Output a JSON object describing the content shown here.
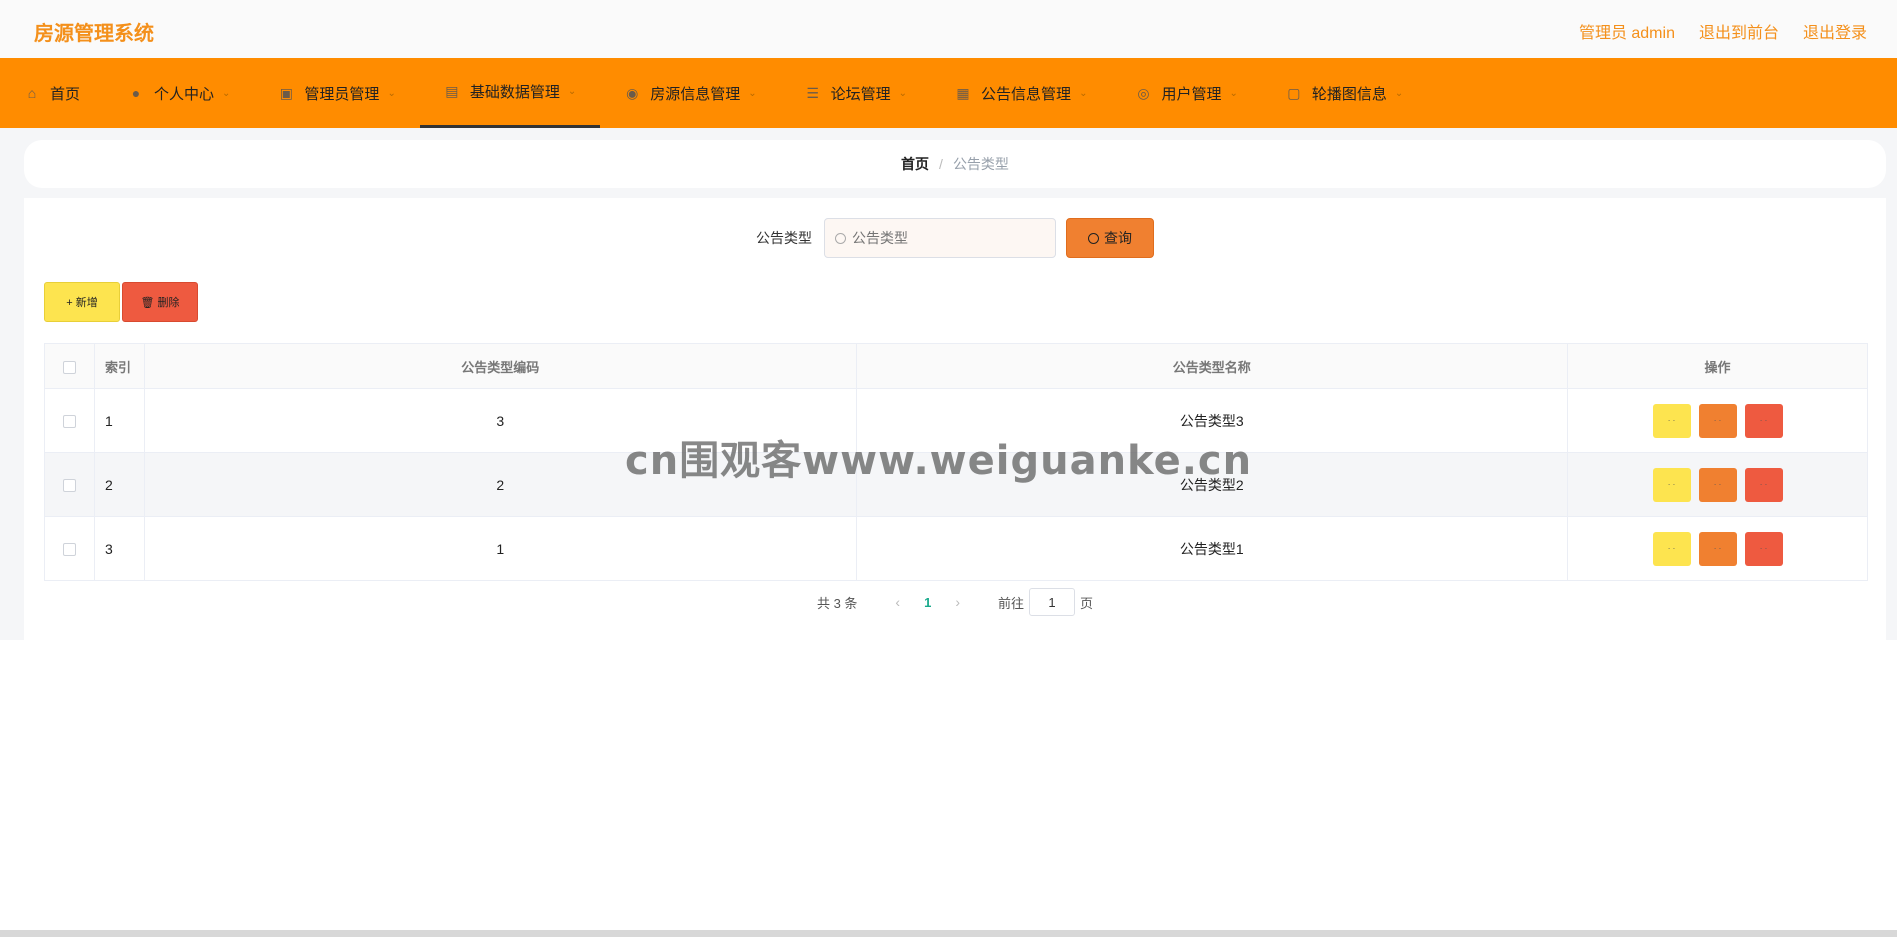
{
  "app": {
    "title": "房源管理系统",
    "top_links": [
      "管理员 admin",
      "退出到前台",
      "退出登录"
    ]
  },
  "nav": {
    "items": [
      {
        "label": "首页",
        "icon": "home-icon",
        "glyph": "⌂",
        "has_menu": false,
        "active": false
      },
      {
        "label": "个人中心",
        "icon": "user-icon",
        "glyph": "●",
        "has_menu": true,
        "active": false
      },
      {
        "label": "管理员管理",
        "icon": "monitor-icon",
        "glyph": "▣",
        "has_menu": true,
        "active": false
      },
      {
        "label": "基础数据管理",
        "icon": "briefcase-icon",
        "glyph": "▤",
        "has_menu": true,
        "active": true
      },
      {
        "label": "房源信息管理",
        "icon": "database-icon",
        "glyph": "◉",
        "has_menu": true,
        "active": false
      },
      {
        "label": "论坛管理",
        "icon": "sliders-icon",
        "glyph": "☰",
        "has_menu": true,
        "active": false
      },
      {
        "label": "公告信息管理",
        "icon": "notice-icon",
        "glyph": "▦",
        "has_menu": true,
        "active": false
      },
      {
        "label": "用户管理",
        "icon": "compass-icon",
        "glyph": "◎",
        "has_menu": true,
        "active": false
      },
      {
        "label": "轮播图信息",
        "icon": "image-icon",
        "glyph": "▢",
        "has_menu": true,
        "active": false
      }
    ]
  },
  "breadcrumb": {
    "home": "首页",
    "separator": "/",
    "current": "公告类型"
  },
  "search": {
    "label": "公告类型",
    "placeholder": "公告类型",
    "value": "",
    "button": "查询"
  },
  "actions": {
    "add": "+ 新增",
    "delete": "🗑 删除"
  },
  "table": {
    "columns": [
      "",
      "索引",
      "公告类型编码",
      "公告类型名称",
      "操作"
    ],
    "rows": [
      {
        "index": "1",
        "code": "3",
        "name": "公告类型3"
      },
      {
        "index": "2",
        "code": "2",
        "name": "公告类型2"
      },
      {
        "index": "3",
        "code": "1",
        "name": "公告类型1"
      }
    ],
    "op_labels": [
      "· ·",
      "· ·",
      "· ·"
    ]
  },
  "pagination": {
    "total": "共 3 条",
    "current": "1",
    "goto_label": "前往",
    "page_input": "1",
    "page_suffix": "页",
    "prev": "‹",
    "next": "›"
  },
  "watermark": "cn围观客www.weiguanke.cn",
  "colors": {
    "brand": "#f4901b",
    "nav_bg": "#ff8c00",
    "add": "#fde44f",
    "edit": "#f08030",
    "delete": "#ee5a40",
    "page_active": "#1aaa8c"
  }
}
